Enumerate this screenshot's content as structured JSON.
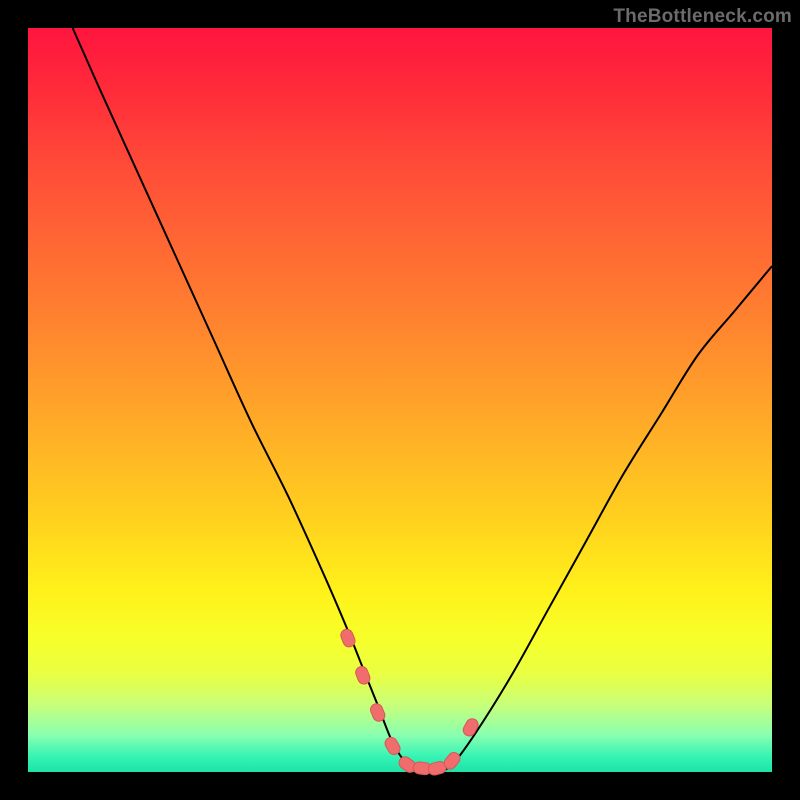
{
  "watermark": "TheBottleneck.com",
  "chart_data": {
    "type": "line",
    "title": "",
    "xlabel": "",
    "ylabel": "",
    "xlim": [
      0,
      100
    ],
    "ylim": [
      0,
      100
    ],
    "note": "Heatmap-style rainbow background with a V-shaped bottleneck curve; axes and ticks are not labeled in the source image, so x and y are normalized 0–100. Values below are estimated from pixel positions.",
    "series": [
      {
        "name": "bottleneck-curve",
        "x": [
          6,
          10,
          15,
          20,
          25,
          30,
          35,
          40,
          43,
          45,
          47,
          49,
          51,
          53,
          55,
          57,
          60,
          65,
          70,
          75,
          80,
          85,
          90,
          95,
          100
        ],
        "values": [
          100,
          91,
          80,
          69,
          58,
          47,
          37,
          26,
          19,
          14,
          9,
          4,
          1,
          0,
          0,
          1,
          5,
          13,
          22,
          31,
          40,
          48,
          56,
          62,
          68
        ]
      }
    ],
    "markers": {
      "name": "highlight-beads",
      "x": [
        43.0,
        45.0,
        47.0,
        49.0,
        51.0,
        53.0,
        55.0,
        57.0,
        59.5
      ],
      "values": [
        18.0,
        13.0,
        8.0,
        3.5,
        1.0,
        0.5,
        0.5,
        1.5,
        6.0
      ]
    }
  }
}
